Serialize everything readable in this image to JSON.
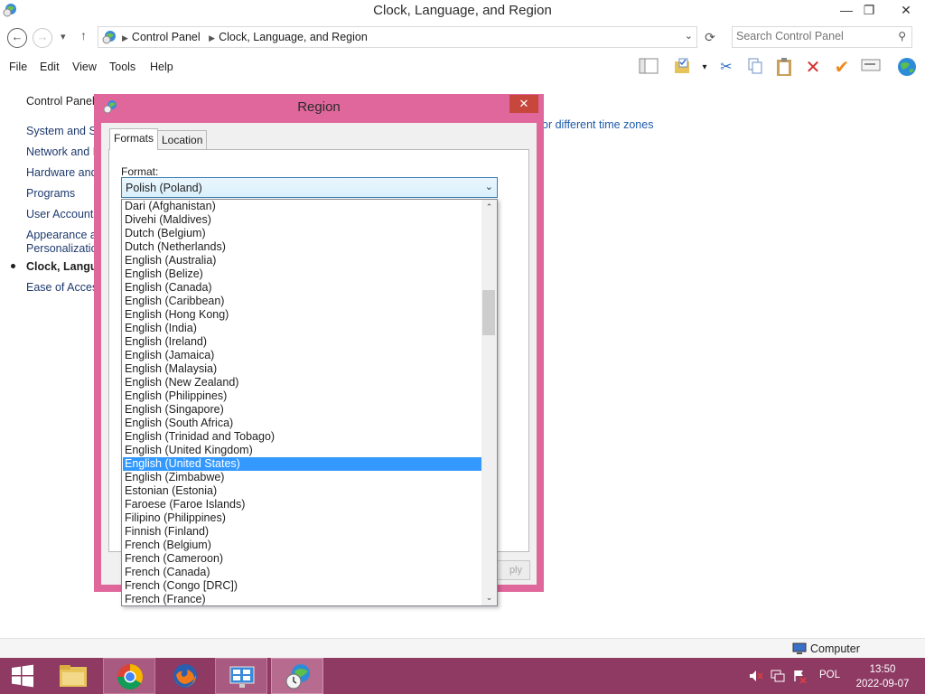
{
  "window": {
    "title": "Clock, Language, and Region",
    "minimize": "—",
    "restore": "❐",
    "close": "✕"
  },
  "address": {
    "crumbs": [
      "Control Panel",
      "Clock, Language, and Region"
    ],
    "search_placeholder": "Search Control Panel"
  },
  "menu": {
    "items": [
      "File",
      "Edit",
      "View",
      "Tools",
      "Help"
    ]
  },
  "leftnav": {
    "home": "Control Panel Home",
    "items": [
      "System and Security",
      "Network and Internet",
      "Hardware and Sound",
      "Programs",
      "User Accounts and Family Safety",
      "Appearance and",
      "Personalization",
      "Clock, Language, and Region",
      "Ease of Access"
    ]
  },
  "main": {
    "link_fragment": "or different time zones"
  },
  "dialog": {
    "title": "Region",
    "close": "✕",
    "tabs": [
      "Formats",
      "Location"
    ],
    "format_label": "Format:",
    "selected_format": "Polish (Poland)",
    "apply_fragment": "ply"
  },
  "dropdown": {
    "options": [
      "Dari (Afghanistan)",
      "Divehi (Maldives)",
      "Dutch (Belgium)",
      "Dutch (Netherlands)",
      "English (Australia)",
      "English (Belize)",
      "English (Canada)",
      "English (Caribbean)",
      "English (Hong Kong)",
      "English (India)",
      "English (Ireland)",
      "English (Jamaica)",
      "English (Malaysia)",
      "English (New Zealand)",
      "English (Philippines)",
      "English (Singapore)",
      "English (South Africa)",
      "English (Trinidad and Tobago)",
      "English (United Kingdom)",
      "English (United States)",
      "English (Zimbabwe)",
      "Estonian (Estonia)",
      "Faroese (Faroe Islands)",
      "Filipino (Philippines)",
      "Finnish (Finland)",
      "French (Belgium)",
      "French (Cameroon)",
      "French (Canada)",
      "French (Congo [DRC])",
      "French (France)"
    ],
    "highlighted": "English (United States)"
  },
  "statusbar": {
    "label": "Computer"
  },
  "taskbar": {
    "language": "POL",
    "time": "13:50",
    "date": "2022-09-07"
  },
  "colors": {
    "dialog_frame": "#e0679b",
    "taskbar": "#8e3a63",
    "selection": "#3399ff",
    "close_button": "#c7473d"
  }
}
